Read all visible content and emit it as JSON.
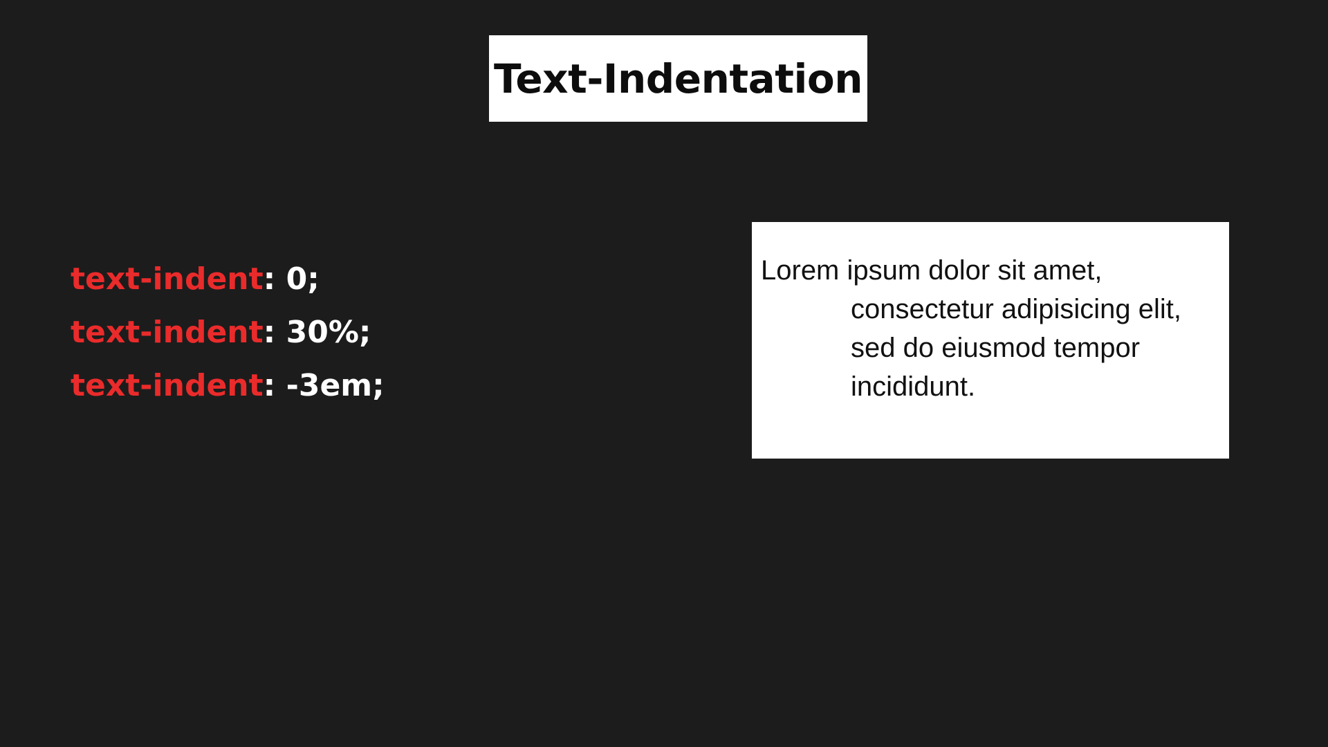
{
  "title": "Text-Indentation",
  "colors": {
    "background": "#1c1c1c",
    "property": "#ea2b2b",
    "value": "#ffffff",
    "panel": "#ffffff"
  },
  "code_lines": [
    {
      "property": "text-indent",
      "colon": ":",
      "value": " 0;"
    },
    {
      "property": "text-indent",
      "colon": ":",
      "value": " 30%;"
    },
    {
      "property": "text-indent",
      "colon": ":",
      "value": " -3em;"
    }
  ],
  "demo": {
    "paragraph": "Lorem ipsum dolor sit amet, consectetur adipisicing elit, sed do eiusmod tempor incididunt."
  }
}
